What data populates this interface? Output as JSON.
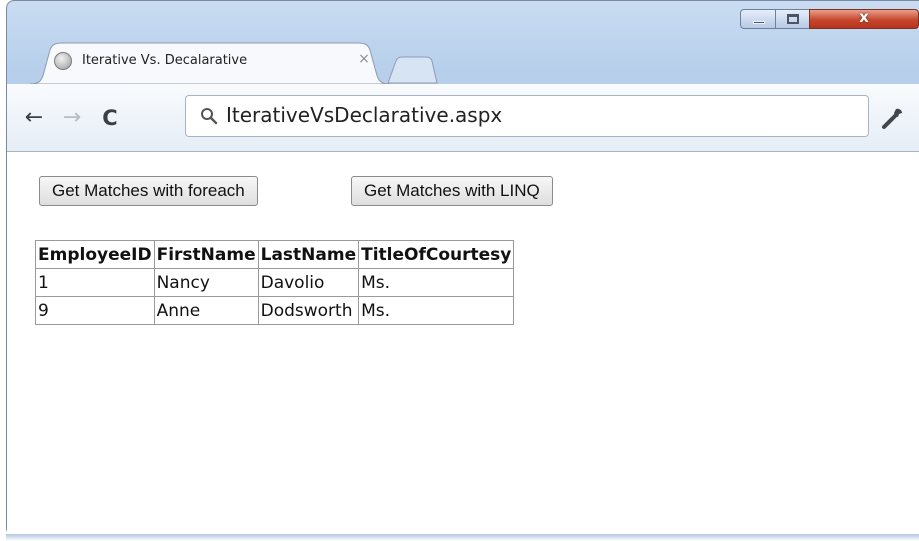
{
  "browser": {
    "tab": {
      "title": "Iterative Vs. Decalarative",
      "close_glyph": "×",
      "favicon": "globe-icon"
    },
    "window_controls": {
      "minimize": "minimize-icon",
      "maximize": "maximize-icon",
      "close_glyph": "x"
    },
    "nav": {
      "back": "←",
      "forward": "→",
      "reload": "C"
    },
    "address": {
      "value": "IterativeVsDeclarative.aspx",
      "icon": "search-icon"
    },
    "settings_icon": "wrench-icon"
  },
  "page": {
    "buttons": {
      "foreach": "Get Matches with foreach",
      "linq": "Get Matches with LINQ"
    },
    "table": {
      "headers": [
        "EmployeeID",
        "FirstName",
        "LastName",
        "TitleOfCourtesy"
      ],
      "rows": [
        [
          "1",
          "Nancy",
          "Davolio",
          "Ms."
        ],
        [
          "9",
          "Anne",
          "Dodsworth",
          "Ms."
        ]
      ]
    }
  },
  "colors": {
    "frame": "#b7cfeb",
    "close_button": "#c7462d",
    "toolbar": "#e5edf6"
  }
}
